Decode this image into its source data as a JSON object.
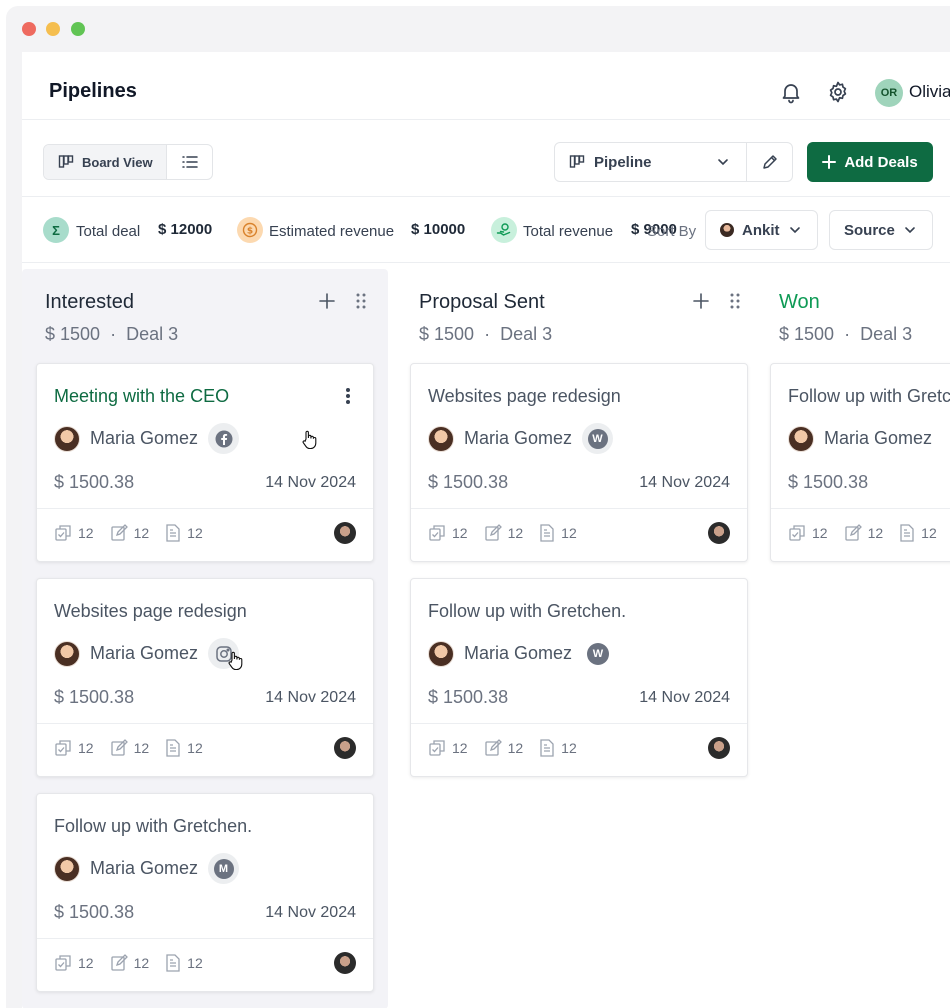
{
  "header": {
    "title": "Pipelines",
    "user_initials": "OR",
    "user_name": "Olivia"
  },
  "toolbar": {
    "board_view_label": "Board View",
    "pipeline_label": "Pipeline",
    "add_deals_label": "Add Deals"
  },
  "stats": {
    "total_deal_label": "Total deal",
    "total_deal_value": "$ 12000",
    "estimated_revenue_label": "Estimated revenue",
    "estimated_revenue_value": "$ 10000",
    "total_revenue_label": "Total revenue",
    "total_revenue_value": "$ 9000",
    "sort_by_label": "Sort By",
    "owner_filter": "Ankit",
    "source_filter": "Source"
  },
  "colors": {
    "primary": "#0e6b42",
    "won": "#0e9a55"
  },
  "columns": [
    {
      "title": "Interested",
      "amount": "$ 1500",
      "separator": "·",
      "deals": "Deal 3",
      "cards": [
        {
          "title": "Meeting with the CEO",
          "person": "Maria Gomez",
          "source_icon": "facebook-icon",
          "amount": "$ 1500.38",
          "date": "14 Nov 2024",
          "tasks": "12",
          "notes": "12",
          "files": "12"
        },
        {
          "title": "Websites page redesign",
          "person": "Maria Gomez",
          "source_icon": "instagram-icon",
          "amount": "$ 1500.38",
          "date": "14 Nov 2024",
          "tasks": "12",
          "notes": "12",
          "files": "12"
        },
        {
          "title": "Follow up with Gretchen.",
          "person": "Maria Gomez",
          "source_icon": "m-badge-icon",
          "badge_letter": "M",
          "amount": "$ 1500.38",
          "date": "14 Nov 2024",
          "tasks": "12",
          "notes": "12",
          "files": "12"
        }
      ]
    },
    {
      "title": "Proposal Sent",
      "amount": "$ 1500",
      "separator": "·",
      "deals": "Deal 3",
      "cards": [
        {
          "title": "Websites page redesign",
          "person": "Maria Gomez",
          "source_icon": "w-badge-icon",
          "badge_letter": "W",
          "amount": "$ 1500.38",
          "date": "14 Nov 2024",
          "tasks": "12",
          "notes": "12",
          "files": "12"
        },
        {
          "title": "Follow up with Gretchen.",
          "person": "Maria Gomez",
          "source_icon": "w-badge-icon",
          "badge_letter": "W",
          "amount": "$ 1500.38",
          "date": "14 Nov 2024",
          "tasks": "12",
          "notes": "12",
          "files": "12"
        }
      ]
    },
    {
      "title": "Won",
      "amount": "$ 1500",
      "separator": "·",
      "deals": "Deal 3",
      "cards": [
        {
          "title": "Follow up with Gretchen.",
          "person": "Maria Gomez",
          "amount": "$ 1500.38",
          "tasks": "12",
          "notes": "12",
          "files": "12"
        }
      ]
    }
  ]
}
